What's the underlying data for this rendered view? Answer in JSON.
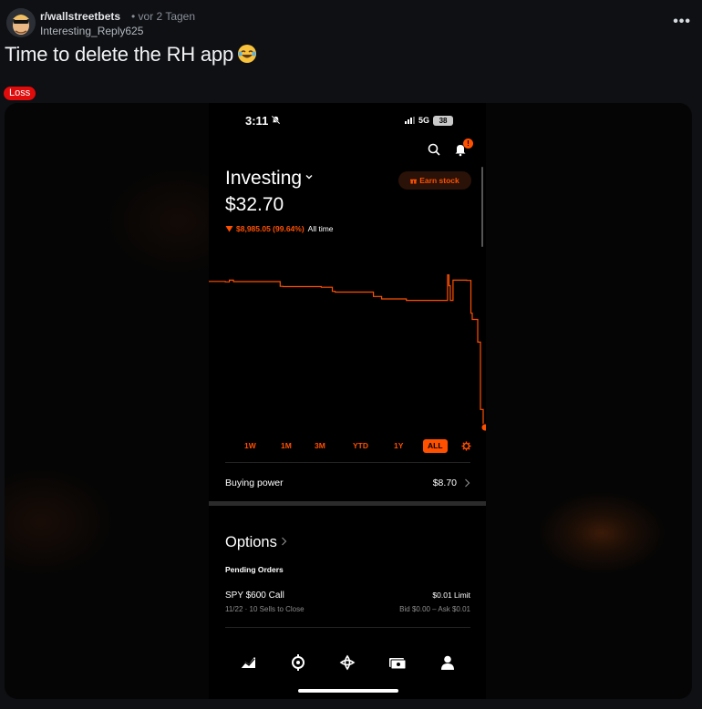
{
  "post": {
    "subreddit": "r/wallstreetbets",
    "time": "• vor 2 Tagen",
    "author": "Interesting_Reply625",
    "title": "Time to delete the RH app",
    "flair": "Loss",
    "more_label": "•••"
  },
  "icons": {
    "avatar": "subreddit-avatar",
    "emoji": "laughing-tears-emoji",
    "more": "more-options-icon"
  },
  "colors": {
    "background": "#0e1014",
    "flair": "#e00b0b",
    "accent": "#ff5000",
    "phone_bg": "#000000"
  },
  "phone": {
    "status": {
      "time": "3:11",
      "network": "5G",
      "battery": "38"
    },
    "header": {
      "notification_badge": "!",
      "account_title": "Investing",
      "earn_stock_label": "Earn stock"
    },
    "portfolio": {
      "balance": "$32.70",
      "change": "$8,985.05 (99.64%)",
      "change_period": "All time"
    },
    "ranges": [
      "1W",
      "1M",
      "3M",
      "YTD",
      "1Y",
      "ALL"
    ],
    "active_range": "ALL",
    "buying_power": {
      "label": "Buying power",
      "value": "$8.70"
    },
    "options": {
      "title": "Options",
      "pending_label": "Pending Orders",
      "order": {
        "name": "SPY $600 Call",
        "detail": "11/22 · 10 Sells to Close",
        "price": "$0.01 Limit",
        "bid_ask": "Bid $0.00 – Ask $0.01"
      }
    },
    "tabs": [
      "investing-tab",
      "crypto-tab",
      "network-tab",
      "cash-tab",
      "account-tab"
    ]
  },
  "chart_data": {
    "type": "line",
    "title": "",
    "xlabel": "",
    "ylabel": "",
    "range": "ALL",
    "series": [
      {
        "values": [
          9017.75,
          9017.75,
          9011,
          9035,
          9014,
          8945,
          8942,
          8942,
          8932,
          8873,
          8862,
          8862,
          8798,
          8762,
          8762,
          8742,
          8742,
          8742,
          8742,
          9111,
          8955,
          8742,
          9035,
          9032,
          8555,
          8465,
          8135,
          7155,
          32.7
        ]
      }
    ],
    "x_fraction": [
      0,
      0.05,
      0.06,
      0.075,
      0.09,
      0.26,
      0.27,
      0.4,
      0.41,
      0.45,
      0.46,
      0.59,
      0.6,
      0.63,
      0.7,
      0.72,
      0.81,
      0.825,
      0.84,
      0.87,
      0.875,
      0.88,
      0.89,
      0.94,
      0.955,
      0.96,
      0.98,
      0.99,
      1.0
    ],
    "ylim": [
      0,
      9200
    ],
    "start_value": 9017.75,
    "end_value": 32.7
  }
}
